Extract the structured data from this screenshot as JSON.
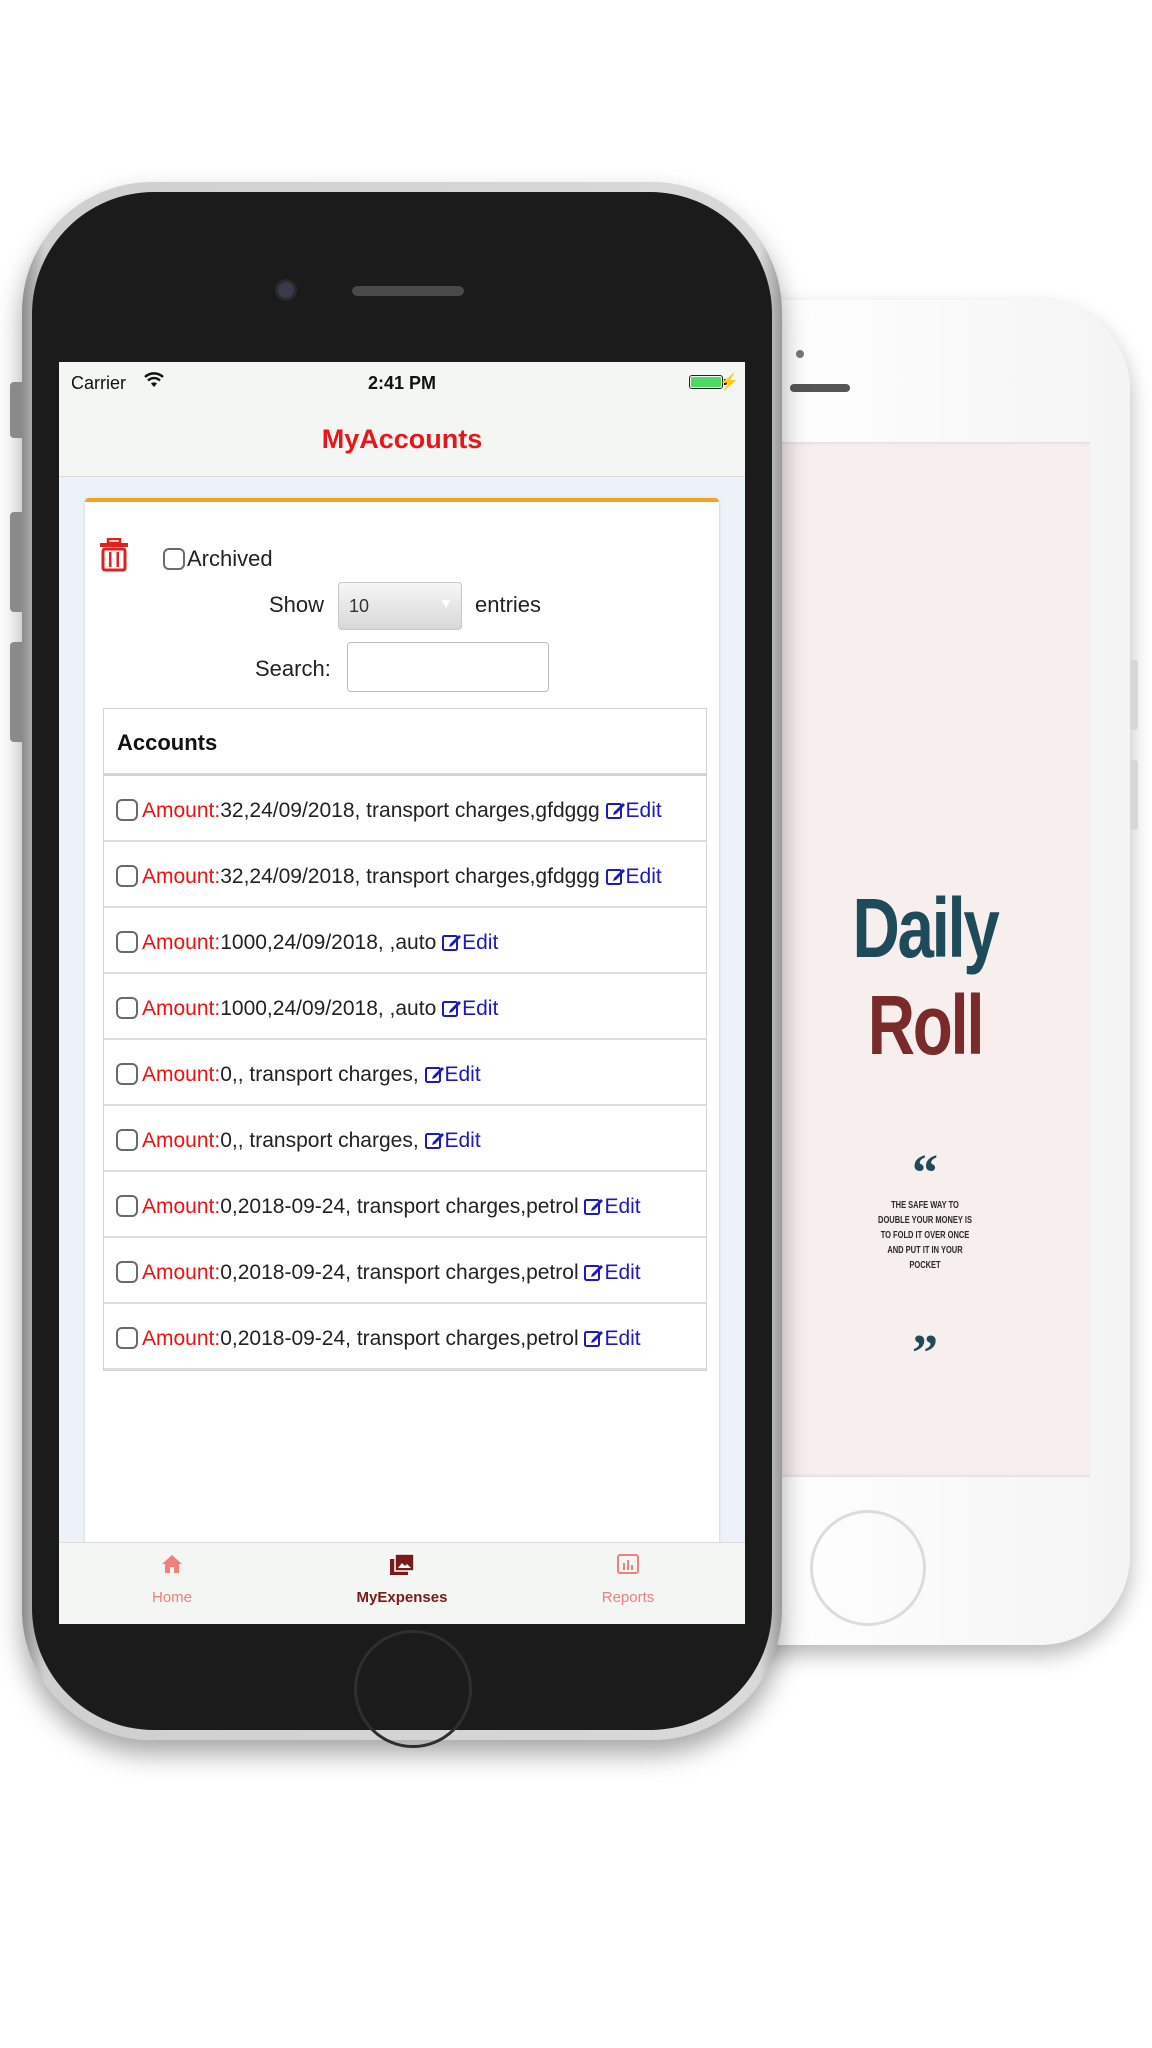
{
  "splash": {
    "title_part1": "Daily",
    "title_part2": " Roll",
    "quote_open": "“",
    "quote_close": "”",
    "quote_text": "The safe way to double your money is to fold it over once and put it in your pocket"
  },
  "status": {
    "carrier": "Carrier",
    "time": "2:41 PM",
    "wifi_icon": "wifi-icon",
    "battery_icon": "battery-icon"
  },
  "nav": {
    "title": "MyAccounts"
  },
  "controls": {
    "archived_label": "Archived",
    "show_label": "Show",
    "entries_select_value": "10",
    "entries_label": "entries",
    "search_label": "Search:",
    "search_value": ""
  },
  "table": {
    "header": "Accounts",
    "amount_label": "Amount:",
    "edit_label": "Edit",
    "rows": [
      "32,24/09/2018, transport charges,gfdggg",
      "32,24/09/2018, transport charges,gfdggg",
      "1000,24/09/2018, ,auto",
      "1000,24/09/2018, ,auto",
      "0,, transport charges,",
      "0,, transport charges,",
      "0,2018-09-24, transport charges,petrol",
      "0,2018-09-24, transport charges,petrol",
      "0,2018-09-24, transport charges,petrol"
    ]
  },
  "tabs": {
    "home": "Home",
    "expenses": "MyExpenses",
    "reports": "Reports"
  },
  "colors": {
    "accent": "#e8151b",
    "card_border": "#f2a227",
    "link": "#1b1bbb",
    "tab_inactive": "#f08080",
    "tab_active": "#7b1a1a"
  }
}
